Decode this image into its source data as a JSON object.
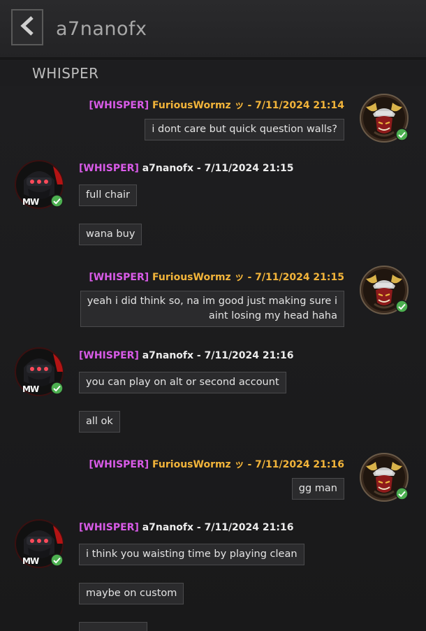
{
  "header": {
    "title": "a7nanofx",
    "back_icon": "chevron-left-icon"
  },
  "section": {
    "label": "WHISPER"
  },
  "messages": [
    {
      "side": "right",
      "tag": "[WHISPER]",
      "user": "FuriousWormz ッ",
      "timestamp": "7/11/2024 21:14",
      "bubbles": [
        "i dont care but quick question walls?"
      ]
    },
    {
      "side": "left",
      "tag": "[WHISPER]",
      "user": "a7nanofx",
      "timestamp": "7/11/2024 21:15",
      "bubbles": [
        "full chair",
        "wana buy"
      ]
    },
    {
      "side": "right",
      "tag": "[WHISPER]",
      "user": "FuriousWormz ッ",
      "timestamp": "7/11/2024 21:15",
      "bubbles": [
        "yeah i did think so, na im good just making sure i",
        "aint losing my head haha"
      ]
    },
    {
      "side": "left",
      "tag": "[WHISPER]",
      "user": "a7nanofx",
      "timestamp": "7/11/2024 21:16",
      "bubbles": [
        "you can play on alt or second account",
        "all ok"
      ]
    },
    {
      "side": "right",
      "tag": "[WHISPER]",
      "user": "FuriousWormz ッ",
      "timestamp": "7/11/2024 21:16",
      "bubbles": [
        "gg man"
      ]
    },
    {
      "side": "left",
      "tag": "[WHISPER]",
      "user": "a7nanofx",
      "timestamp": "7/11/2024 21:16",
      "bubbles": [
        "i think you waisting time by playing clean",
        "maybe on custom"
      ]
    }
  ],
  "separator": " - ",
  "avatar_badges": {
    "mw3_text": "MW",
    "online_icon": "check-circle-icon"
  },
  "colors": {
    "tag": "#d95be8",
    "self_name": "#f2b43a",
    "other_name": "#ececec",
    "online": "#4caf50"
  }
}
